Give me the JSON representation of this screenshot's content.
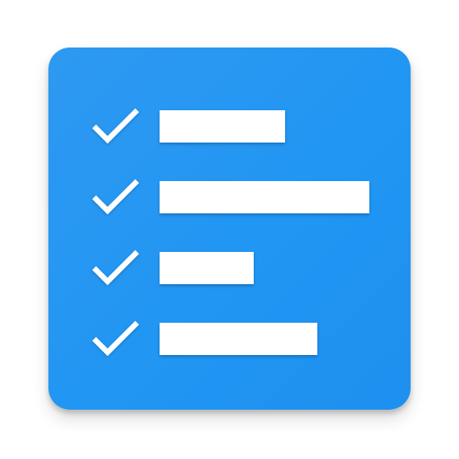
{
  "icon": {
    "name": "checklist-app-icon",
    "background_color": "#2196f3",
    "foreground_color": "#ffffff"
  },
  "list": {
    "items": [
      {
        "checked": true,
        "icon": "check-icon",
        "line_length": 0.6
      },
      {
        "checked": true,
        "icon": "check-icon",
        "line_length": 1.0
      },
      {
        "checked": true,
        "icon": "check-icon",
        "line_length": 0.45
      },
      {
        "checked": true,
        "icon": "check-icon",
        "line_length": 0.75
      }
    ]
  }
}
